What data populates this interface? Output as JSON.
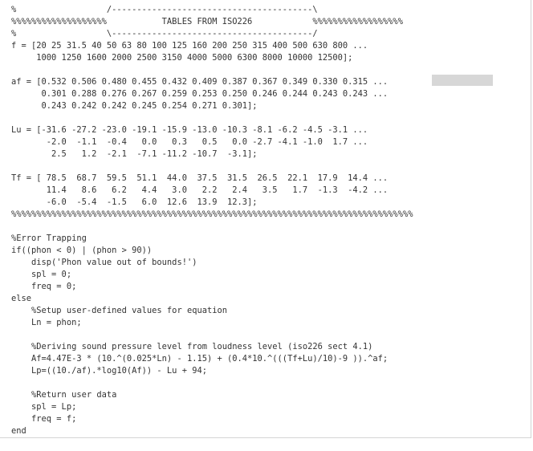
{
  "code": {
    "lines": [
      "%                  /----------------------------------------\\",
      "%%%%%%%%%%%%%%%%%%%           TABLES FROM ISO226            %%%%%%%%%%%%%%%%%%",
      "%                  \\----------------------------------------/",
      "f = [20 25 31.5 40 50 63 80 100 125 160 200 250 315 400 500 630 800 ...",
      "     1000 1250 1600 2000 2500 3150 4000 5000 6300 8000 10000 12500];",
      "",
      "af = [0.532 0.506 0.480 0.455 0.432 0.409 0.387 0.367 0.349 0.330 0.315 ...",
      "      0.301 0.288 0.276 0.267 0.259 0.253 0.250 0.246 0.244 0.243 0.243 ...",
      "      0.243 0.242 0.242 0.245 0.254 0.271 0.301];",
      "",
      "Lu = [-31.6 -27.2 -23.0 -19.1 -15.9 -13.0 -10.3 -8.1 -6.2 -4.5 -3.1 ...",
      "       -2.0  -1.1  -0.4   0.0   0.3   0.5   0.0 -2.7 -4.1 -1.0  1.7 ...",
      "        2.5   1.2  -2.1  -7.1 -11.2 -10.7  -3.1];",
      "",
      "Tf = [ 78.5  68.7  59.5  51.1  44.0  37.5  31.5  26.5  22.1  17.9  14.4 ...",
      "       11.4   8.6   6.2   4.4   3.0   2.2   2.4   3.5   1.7  -1.3  -4.2 ...",
      "       -6.0  -5.4  -1.5   6.0  12.6  13.9  12.3];",
      "%%%%%%%%%%%%%%%%%%%%%%%%%%%%%%%%%%%%%%%%%%%%%%%%%%%%%%%%%%%%%%%%%%%%%%%%%%%%%%%%",
      "",
      "%Error Trapping",
      "if((phon < 0) | (phon > 90))",
      "    disp('Phon value out of bounds!')",
      "    spl = 0;",
      "    freq = 0;",
      "else",
      "    %Setup user-defined values for equation",
      "    Ln = phon;",
      "",
      "    %Deriving sound pressure level from loudness level (iso226 sect 4.1)",
      "    Af=4.47E-3 * (10.^(0.025*Ln) - 1.15) + (0.4*10.^(((Tf+Lu)/10)-9 )).^af;",
      "    Lp=((10./af).*log10(Af)) - Lu + 94;",
      "",
      "    %Return user data",
      "    spl = Lp;",
      "    freq = f;",
      "end"
    ]
  },
  "colors": {
    "text": "#333333",
    "background": "#ffffff",
    "highlight": "#d7d7d7",
    "border": "#d4d4d4"
  }
}
